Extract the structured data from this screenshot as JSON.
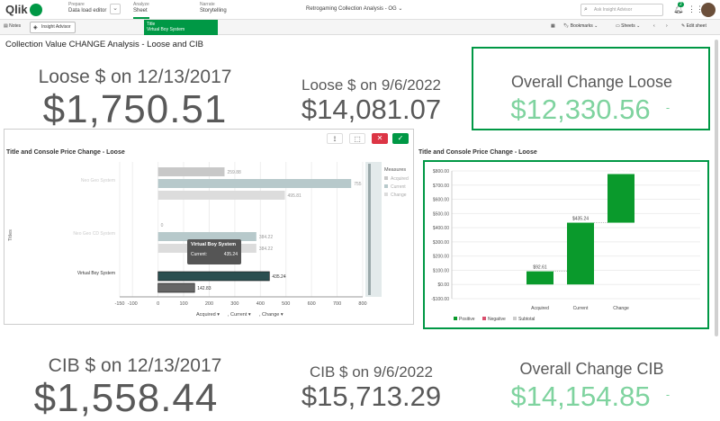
{
  "topnav": {
    "logo": "Qlik",
    "stages": [
      {
        "top": "Prepare",
        "bottom": "Data load editor"
      },
      {
        "top": "Analyze",
        "bottom": "Sheet"
      },
      {
        "top": "Narrate",
        "bottom": "Storytelling"
      }
    ],
    "app_title": "Retrogaming Collection Analysis - OG",
    "search_placeholder": "Ask Insight Advisor",
    "notification_count": "2"
  },
  "toolbar": {
    "notes": "Notes",
    "insight_advisor": "Insight Advisor",
    "active_tab_line1": "Title",
    "active_tab_line2": "Virtual Boy System",
    "bookmarks": "Bookmarks",
    "sheets": "Sheets",
    "edit_sheet": "Edit sheet"
  },
  "sheet": {
    "title": "Collection Value CHANGE Analysis - Loose and CIB"
  },
  "kpis": {
    "loose_2017_label": "Loose $ on 12/13/2017",
    "loose_2017_value": "$1,750.51",
    "loose_2022_label": "Loose $ on 9/6/2022",
    "loose_2022_value": "$14,081.07",
    "loose_change_label": "Overall Change Loose",
    "loose_change_value": "$12,330.56",
    "cib_2017_label": "CIB $ on 12/13/2017",
    "cib_2017_value": "$1,558.44",
    "cib_2022_label": "CIB $ on 9/6/2022",
    "cib_2022_value": "$15,713.29",
    "cib_change_label": "Overall Change CIB",
    "cib_change_value": "$14,154.85"
  },
  "colors": {
    "accent": "#009845",
    "kpi_green": "#7fd39f",
    "bar_acquired": "#c8c8c8",
    "bar_current": "#b7c9cb",
    "bar_change": "#dcdcdc",
    "bar_selected": "#2a4f50",
    "wf_positive": "#0a9a2c",
    "wf_negative": "#d94f6e"
  },
  "chart_data": [
    {
      "type": "bar",
      "orientation": "horizontal",
      "title": "Title and Console Price Change - Loose",
      "ylabel": "Titles",
      "categories": [
        "Neo Geo System",
        "Neo Geo CD System",
        "Virtual Boy System"
      ],
      "series": [
        {
          "name": "Acquired",
          "values": [
            259.88,
            0,
            0
          ]
        },
        {
          "name": "Current",
          "values": [
            755,
            384.22,
            435.24
          ]
        },
        {
          "name": "Change",
          "values": [
            495.81,
            384.22,
            142.83
          ]
        }
      ],
      "bar_labels": [
        [
          "259.88",
          "755",
          "495.81"
        ],
        [
          "0",
          "384.22",
          "384.22"
        ],
        [
          "",
          "435.24",
          "142.83"
        ]
      ],
      "xticks": [
        "-150",
        "-100",
        "0",
        "100",
        "200",
        "300",
        "400",
        "500",
        "600",
        "700",
        "800"
      ],
      "xlim": [
        -150,
        800
      ],
      "legend_title": "Measures",
      "legend": [
        "Acquired",
        "Current",
        "Change"
      ],
      "legend_position": "right",
      "dimension_selectors": [
        "Acquired",
        "Current",
        "Change"
      ],
      "tooltip": {
        "title": "Virtual Boy System",
        "label": "Current:",
        "value": "435.24"
      }
    },
    {
      "type": "bar",
      "subtype": "waterfall",
      "title": "Title and Console Price Change - Loose",
      "categories": [
        "Acquired",
        "Current",
        "Change"
      ],
      "values": [
        92.61,
        435.24,
        342.63
      ],
      "bar_labels": [
        "$92.61",
        "$435.24",
        "$342.63"
      ],
      "yticks": [
        "$800.00",
        "$700.00",
        "$600.00",
        "$500.00",
        "$400.00",
        "$300.00",
        "$200.00",
        "$100.00",
        "$0.00",
        "-$100.00"
      ],
      "ylim": [
        -100,
        800
      ],
      "legend": [
        "Positive",
        "Negative",
        "Subtotal"
      ],
      "legend_position": "bottom"
    }
  ]
}
